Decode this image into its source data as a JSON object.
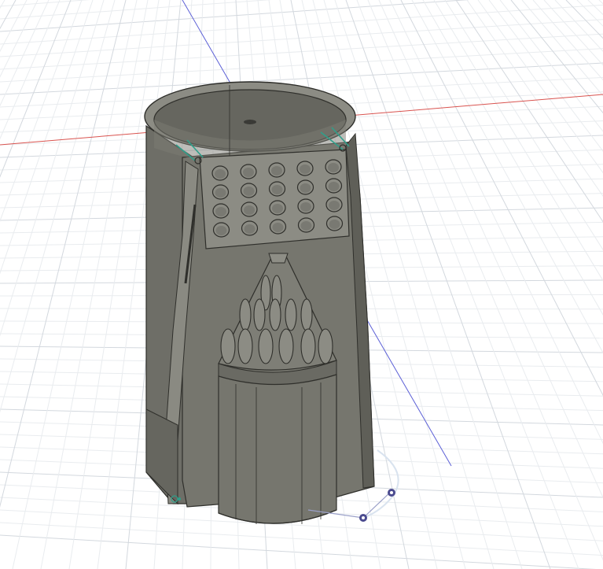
{
  "viewport": {
    "background": "#ffffff",
    "colors": {
      "grid_minor": "#e9ecef",
      "grid_major": "#d3d8de",
      "x_axis": "#d9534f",
      "z_axis": "#5b5fd6",
      "model_fill": "#76766e",
      "model_dark": "#55554f",
      "model_light": "#8c8c84",
      "model_edge": "#2f2f2b",
      "sketch_line": "#2f9f8a",
      "joint_marker": "#4b4b8f"
    },
    "grid_visible": true
  },
  "model": {
    "perforation_grid": {
      "rows": 4,
      "columns": 5
    },
    "cone_slot_rows": 3
  },
  "icons": {
    "origin": "origin-point-icon",
    "joint": "joint-marker-icon",
    "sketch_point": "sketch-point-icon"
  }
}
